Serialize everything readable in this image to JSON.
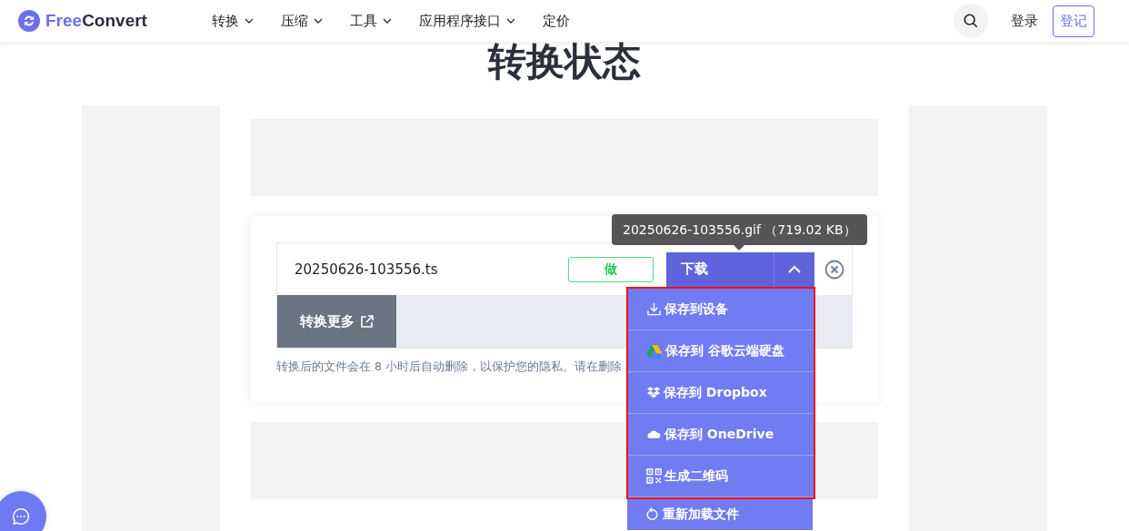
{
  "header": {
    "brand": {
      "part1": "Free",
      "part2": "Convert"
    },
    "nav": [
      {
        "label": "转换",
        "has_dropdown": true
      },
      {
        "label": "压缩",
        "has_dropdown": true
      },
      {
        "label": "工具",
        "has_dropdown": true
      },
      {
        "label": "应用程序接口",
        "has_dropdown": true
      },
      {
        "label": "定价",
        "has_dropdown": false
      }
    ],
    "login": "登录",
    "signup": "登记"
  },
  "title": "转换状态",
  "file": {
    "name": "20250626-103556.ts",
    "status": "做",
    "download": "下载",
    "convert_more": "转换更多"
  },
  "tooltip": "20250626-103556.gif （719.02 KB）",
  "note": "转换后的文件会在 8 小时后自动删除，以保护您的隐私。请在删除",
  "menu": {
    "items": [
      {
        "kind": "device",
        "label": "保存到设备"
      },
      {
        "kind": "gdrive",
        "label": "保存到 谷歌云端硬盘"
      },
      {
        "kind": "dropbox",
        "label": "保存到 Dropbox"
      },
      {
        "kind": "onedrive",
        "label": "保存到 OneDrive"
      },
      {
        "kind": "qrcode",
        "label": "生成二维码"
      }
    ],
    "footer_item": {
      "kind": "reload",
      "label": "重新加载文件"
    }
  }
}
